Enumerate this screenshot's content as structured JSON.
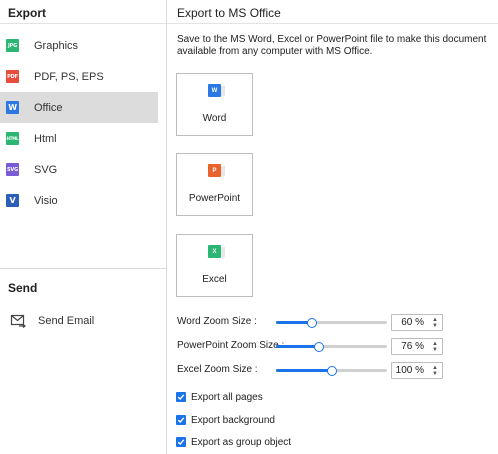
{
  "left": {
    "title": "Export",
    "formats": [
      {
        "label": "Graphics",
        "icon": "jpg-icon",
        "badge": "JPG",
        "color": "#2bb673",
        "selected": false
      },
      {
        "label": "PDF, PS, EPS",
        "icon": "pdf-icon",
        "badge": "PDF",
        "color": "#e84c3d",
        "selected": false
      },
      {
        "label": "Office",
        "icon": "word-icon",
        "badge": "W",
        "color": "#2b78e4",
        "selected": true
      },
      {
        "label": "Html",
        "icon": "html-icon",
        "badge": "HTML",
        "color": "#2bb673",
        "selected": false
      },
      {
        "label": "SVG",
        "icon": "svg-icon",
        "badge": "SVG",
        "color": "#7b5cd6",
        "selected": false
      },
      {
        "label": "Visio",
        "icon": "visio-icon",
        "badge": "V",
        "color": "#2b5fb8",
        "selected": false
      }
    ],
    "send_title": "Send",
    "send_email": "Send Email"
  },
  "right": {
    "title": "Export to MS Office",
    "description": "Save to the MS Word, Excel or PowerPoint file to make this document available from any computer with MS Office.",
    "cards": [
      {
        "label": "Word",
        "icon": "word-doc-icon",
        "badge": "W",
        "color": "#2b78e4"
      },
      {
        "label": "PowerPoint",
        "icon": "powerpoint-doc-icon",
        "badge": "P",
        "color": "#e8642c"
      },
      {
        "label": "Excel",
        "icon": "excel-doc-icon",
        "badge": "X",
        "color": "#2bb673"
      }
    ],
    "zoom": [
      {
        "label": "Word Zoom Size :",
        "value": "60 %",
        "level": 0.32
      },
      {
        "label": "PowerPoint Zoom Size :",
        "value": "76 %",
        "level": 0.39
      },
      {
        "label": "Excel Zoom Size :",
        "value": "100 %",
        "level": 0.5
      }
    ],
    "options": [
      {
        "label": "Export all pages",
        "checked": true
      },
      {
        "label": "Export background",
        "checked": true
      },
      {
        "label": "Export as group object",
        "checked": true
      }
    ]
  },
  "colors": {
    "accent": "#1a73e8",
    "selected_bg": "#dcdcdc"
  }
}
